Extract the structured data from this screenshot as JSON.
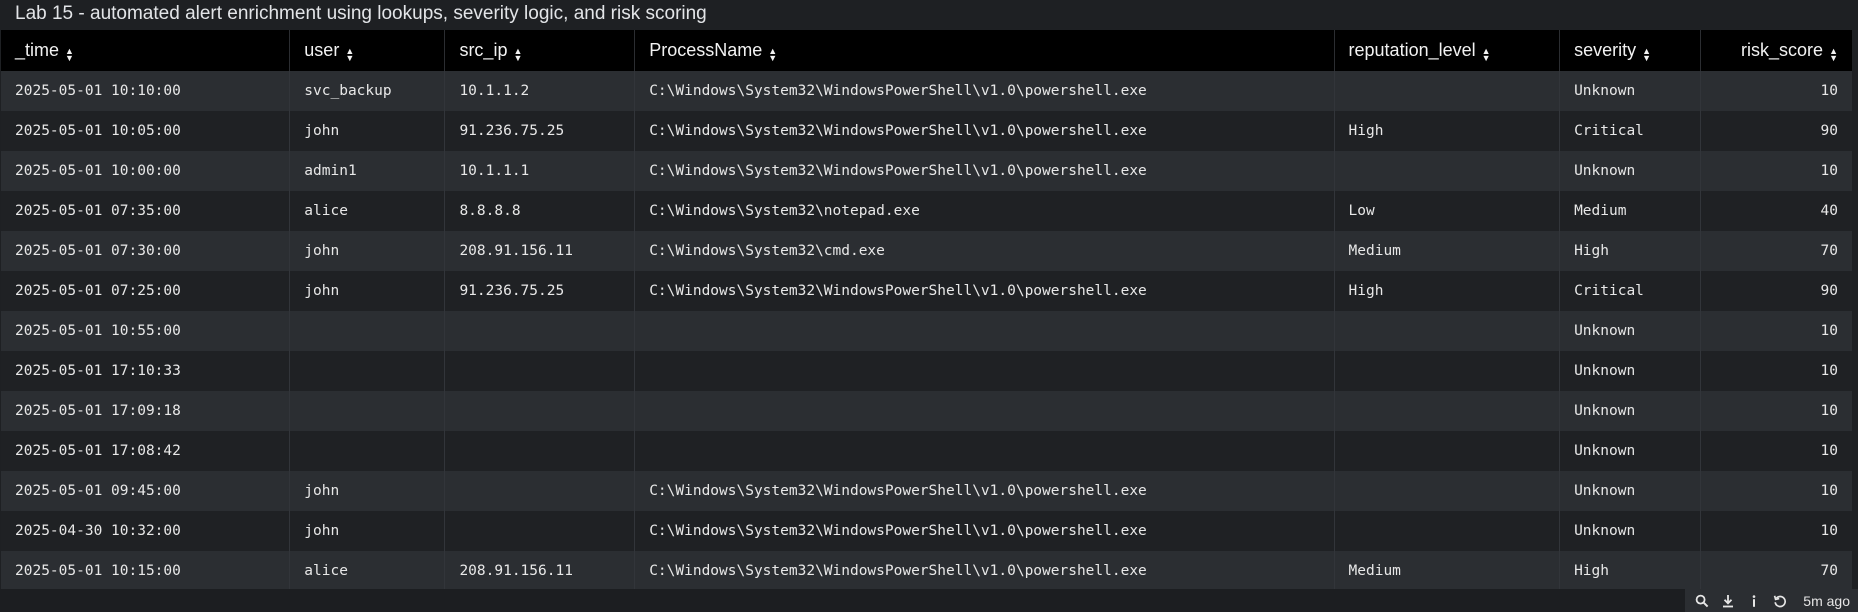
{
  "panel": {
    "title": "Lab 15 - automated alert enrichment using lookups, severity logic, and risk scoring"
  },
  "table": {
    "columns": [
      {
        "key": "_time",
        "label": "_time",
        "align": "left"
      },
      {
        "key": "user",
        "label": "user",
        "align": "left"
      },
      {
        "key": "src_ip",
        "label": "src_ip",
        "align": "left"
      },
      {
        "key": "ProcessName",
        "label": "ProcessName",
        "align": "left"
      },
      {
        "key": "reputation_level",
        "label": "reputation_level",
        "align": "left"
      },
      {
        "key": "severity",
        "label": "severity",
        "align": "left"
      },
      {
        "key": "risk_score",
        "label": "risk_score",
        "align": "right"
      }
    ],
    "rows": [
      {
        "_time": "2025-05-01 10:10:00",
        "user": "svc_backup",
        "src_ip": "10.1.1.2",
        "ProcessName": "C:\\Windows\\System32\\WindowsPowerShell\\v1.0\\powershell.exe",
        "reputation_level": "",
        "severity": "Unknown",
        "risk_score": "10"
      },
      {
        "_time": "2025-05-01 10:05:00",
        "user": "john",
        "src_ip": "91.236.75.25",
        "ProcessName": "C:\\Windows\\System32\\WindowsPowerShell\\v1.0\\powershell.exe",
        "reputation_level": "High",
        "severity": "Critical",
        "risk_score": "90"
      },
      {
        "_time": "2025-05-01 10:00:00",
        "user": "admin1",
        "src_ip": "10.1.1.1",
        "ProcessName": "C:\\Windows\\System32\\WindowsPowerShell\\v1.0\\powershell.exe",
        "reputation_level": "",
        "severity": "Unknown",
        "risk_score": "10"
      },
      {
        "_time": "2025-05-01 07:35:00",
        "user": "alice",
        "src_ip": "8.8.8.8",
        "ProcessName": "C:\\Windows\\System32\\notepad.exe",
        "reputation_level": "Low",
        "severity": "Medium",
        "risk_score": "40"
      },
      {
        "_time": "2025-05-01 07:30:00",
        "user": "john",
        "src_ip": "208.91.156.11",
        "ProcessName": "C:\\Windows\\System32\\cmd.exe",
        "reputation_level": "Medium",
        "severity": "High",
        "risk_score": "70"
      },
      {
        "_time": "2025-05-01 07:25:00",
        "user": "john",
        "src_ip": "91.236.75.25",
        "ProcessName": "C:\\Windows\\System32\\WindowsPowerShell\\v1.0\\powershell.exe",
        "reputation_level": "High",
        "severity": "Critical",
        "risk_score": "90"
      },
      {
        "_time": "2025-05-01 10:55:00",
        "user": "",
        "src_ip": "",
        "ProcessName": "",
        "reputation_level": "",
        "severity": "Unknown",
        "risk_score": "10"
      },
      {
        "_time": "2025-05-01 17:10:33",
        "user": "",
        "src_ip": "",
        "ProcessName": "",
        "reputation_level": "",
        "severity": "Unknown",
        "risk_score": "10"
      },
      {
        "_time": "2025-05-01 17:09:18",
        "user": "",
        "src_ip": "",
        "ProcessName": "",
        "reputation_level": "",
        "severity": "Unknown",
        "risk_score": "10"
      },
      {
        "_time": "2025-05-01 17:08:42",
        "user": "",
        "src_ip": "",
        "ProcessName": "",
        "reputation_level": "",
        "severity": "Unknown",
        "risk_score": "10"
      },
      {
        "_time": "2025-05-01 09:45:00",
        "user": "john",
        "src_ip": "",
        "ProcessName": "C:\\Windows\\System32\\WindowsPowerShell\\v1.0\\powershell.exe",
        "reputation_level": "",
        "severity": "Unknown",
        "risk_score": "10"
      },
      {
        "_time": "2025-04-30 10:32:00",
        "user": "john",
        "src_ip": "",
        "ProcessName": "C:\\Windows\\System32\\WindowsPowerShell\\v1.0\\powershell.exe",
        "reputation_level": "",
        "severity": "Unknown",
        "risk_score": "10"
      },
      {
        "_time": "2025-05-01 10:15:00",
        "user": "alice",
        "src_ip": "208.91.156.11",
        "ProcessName": "C:\\Windows\\System32\\WindowsPowerShell\\v1.0\\powershell.exe",
        "reputation_level": "Medium",
        "severity": "High",
        "risk_score": "70"
      }
    ]
  },
  "footer": {
    "tools": [
      {
        "name": "search-icon",
        "label": "Open in Search"
      },
      {
        "name": "download-icon",
        "label": "Export"
      },
      {
        "name": "info-icon",
        "label": "Inspect"
      },
      {
        "name": "refresh-icon",
        "label": "Refresh"
      }
    ],
    "updated_label": "5m ago"
  },
  "colors": {
    "background": "#1e2023",
    "header_background": "#000000",
    "row_odd": "#2b2e32",
    "row_even": "#1f2124",
    "text": "#e8e8e8"
  }
}
